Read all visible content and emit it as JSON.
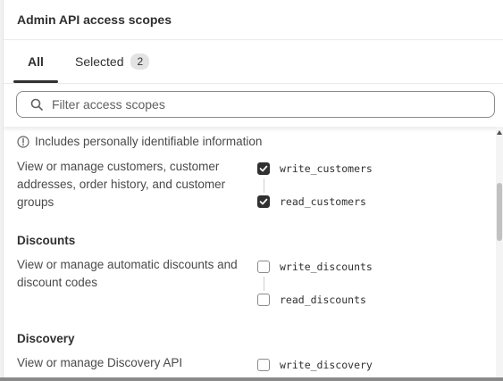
{
  "header": {
    "title": "Admin API access scopes"
  },
  "tabs": [
    {
      "label": "All",
      "active": true
    },
    {
      "label": "Selected",
      "count": "2",
      "active": false
    }
  ],
  "search": {
    "placeholder": "Filter access scopes",
    "value": ""
  },
  "pii_notice": "Includes personally identifiable information",
  "groups": [
    {
      "title": "",
      "description": "View or manage customers, customer addresses, order history, and customer groups",
      "scopes": [
        {
          "name": "write_customers",
          "checked": true
        },
        {
          "name": "read_customers",
          "checked": true
        }
      ]
    },
    {
      "title": "Discounts",
      "description": "View or manage automatic discounts and discount codes",
      "scopes": [
        {
          "name": "write_discounts",
          "checked": false
        },
        {
          "name": "read_discounts",
          "checked": false
        }
      ]
    },
    {
      "title": "Discovery",
      "description": "View or manage Discovery API",
      "scopes": [
        {
          "name": "write_discovery",
          "checked": false
        }
      ]
    }
  ],
  "colors": {
    "checked": "#303030",
    "border": "#8a8a8a",
    "text": "#303030",
    "muted": "#4a4a4a"
  }
}
